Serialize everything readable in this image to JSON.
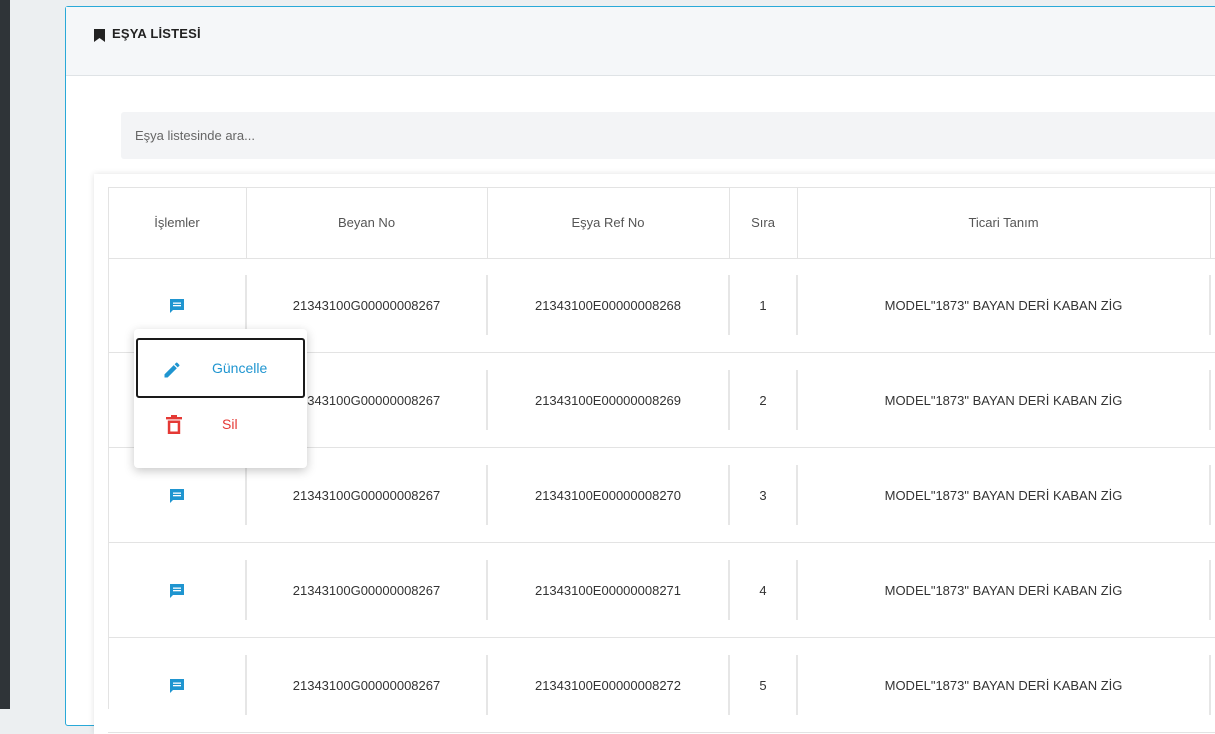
{
  "panel": {
    "title": "EŞYA LİSTESİ",
    "search_placeholder": "Eşya listesinde ara..."
  },
  "table": {
    "columns": [
      "İşlemler",
      "Beyan No",
      "Eşya Ref No",
      "Sıra",
      "Ticari Tanım"
    ],
    "rows": [
      {
        "beyan_no": "21343100G00000008267",
        "esya_ref_no": "21343100E00000008268",
        "sira": "1",
        "ticari_tanim": "MODEL\"1873\" BAYAN DERİ KABAN ZİG"
      },
      {
        "beyan_no": "21343100G00000008267",
        "esya_ref_no": "21343100E00000008269",
        "sira": "2",
        "ticari_tanim": "MODEL\"1873\" BAYAN DERİ KABAN ZİG"
      },
      {
        "beyan_no": "21343100G00000008267",
        "esya_ref_no": "21343100E00000008270",
        "sira": "3",
        "ticari_tanim": "MODEL\"1873\" BAYAN DERİ KABAN ZİG"
      },
      {
        "beyan_no": "21343100G00000008267",
        "esya_ref_no": "21343100E00000008271",
        "sira": "4",
        "ticari_tanim": "MODEL\"1873\" BAYAN DERİ KABAN ZİG"
      },
      {
        "beyan_no": "21343100G00000008267",
        "esya_ref_no": "21343100E00000008272",
        "sira": "5",
        "ticari_tanim": "MODEL\"1873\" BAYAN DERİ KABAN ZİG"
      }
    ]
  },
  "menu": {
    "update_label": "Güncelle",
    "delete_label": "Sil"
  },
  "colors": {
    "accent": "#1f95d0",
    "danger": "#e53935",
    "panel_border": "#29a9d8"
  },
  "icons": {
    "header": "bookmark-icon",
    "row_action": "comment-icon",
    "update": "pencil-icon",
    "delete": "trash-icon"
  }
}
